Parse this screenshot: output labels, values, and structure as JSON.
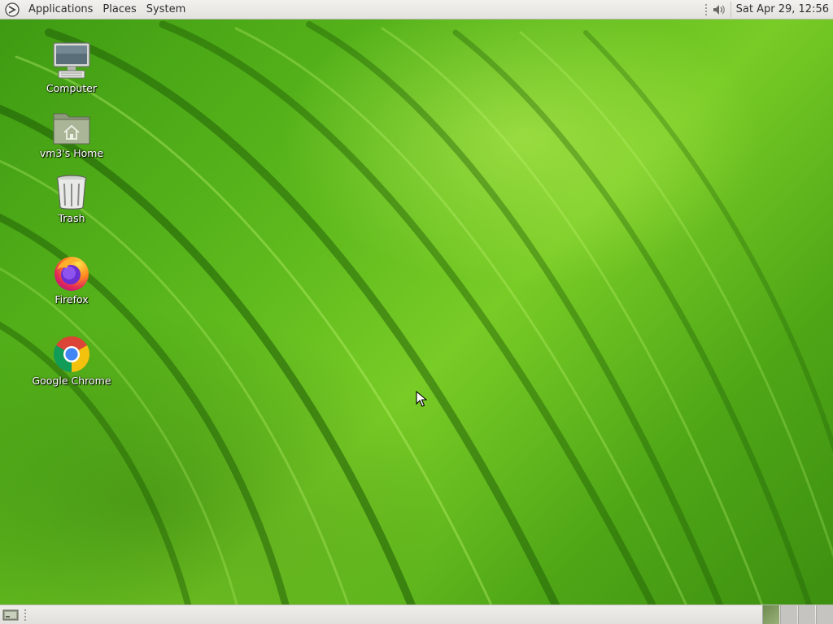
{
  "top_panel": {
    "menus": {
      "applications": "Applications",
      "places": "Places",
      "system": "System"
    },
    "clock": "Sat Apr 29, 12:56",
    "icons": {
      "logo": "gnome-foot-icon",
      "volume": "speaker-volume-icon"
    }
  },
  "desktop": {
    "icons": [
      {
        "label": "Computer",
        "icon": "computer-monitor-icon"
      },
      {
        "label": "vm3's Home",
        "icon": "home-folder-icon"
      },
      {
        "label": "Trash",
        "icon": "trash-can-icon"
      },
      {
        "label": "Firefox",
        "icon": "firefox-icon"
      },
      {
        "label": "Google Chrome",
        "icon": "chrome-icon"
      }
    ]
  },
  "bottom_panel": {
    "icons": {
      "show_desktop": "show-desktop-icon"
    },
    "workspaces": 4,
    "active_workspace": 1
  },
  "colors": {
    "wallpaper_green": "#5cb81c",
    "panel_bg": "#e9e8e4",
    "label_text": "#ffffff"
  }
}
